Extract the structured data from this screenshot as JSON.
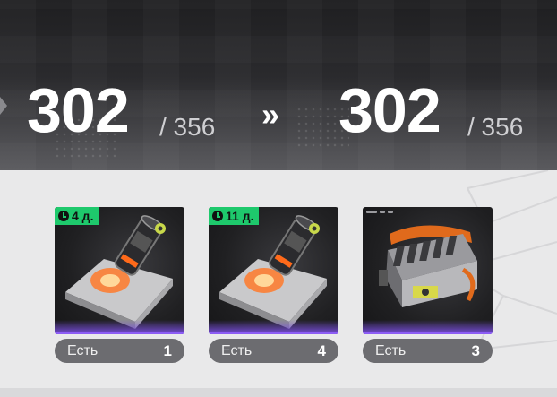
{
  "level": {
    "current": {
      "value": "302",
      "max": "/ 356"
    },
    "arrow": "»",
    "next": {
      "value": "302",
      "max": "/ 356"
    }
  },
  "items": [
    {
      "timer": "4 д.",
      "have_label": "Есть",
      "count": "1",
      "icon": "grenade-canister-icon"
    },
    {
      "timer": "11 д.",
      "have_label": "Есть",
      "count": "4",
      "icon": "grenade-canister-icon"
    },
    {
      "timer": null,
      "have_label": "Есть",
      "count": "3",
      "icon": "engine-block-icon"
    }
  ],
  "colors": {
    "timer_bg": "#1ec96c",
    "rarity": "#8c5cf5",
    "count_bg": "#6c6c70"
  }
}
